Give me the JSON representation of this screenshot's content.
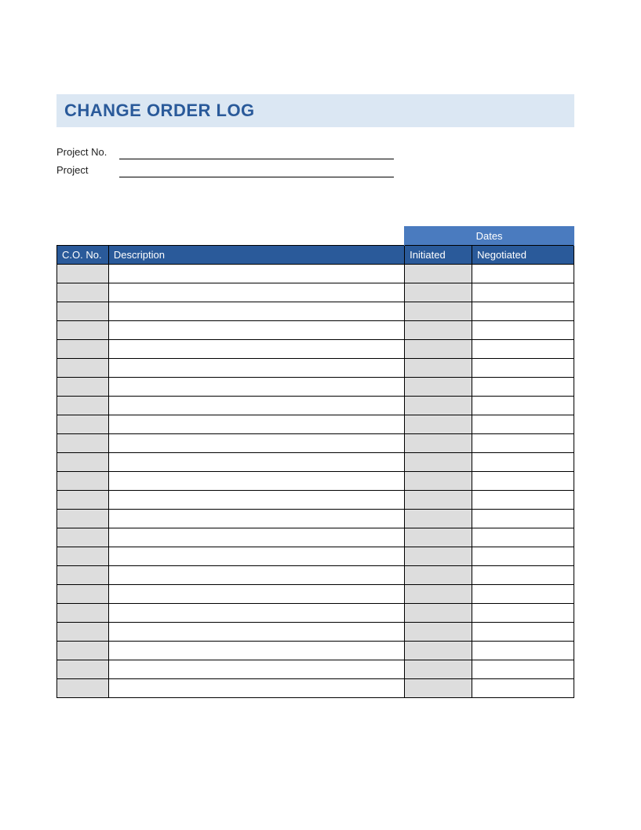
{
  "title": "CHANGE ORDER LOG",
  "meta": {
    "project_no_label": "Project No.",
    "project_no_value": "",
    "project_label": "Project",
    "project_value": ""
  },
  "table": {
    "group_header": "Dates",
    "headers": {
      "co_no": "C.O. No.",
      "description": "Description",
      "initiated": "Initiated",
      "negotiated": "Negotiated"
    },
    "rows": [
      {
        "co_no": "",
        "description": "",
        "initiated": "",
        "negotiated": ""
      },
      {
        "co_no": "",
        "description": "",
        "initiated": "",
        "negotiated": ""
      },
      {
        "co_no": "",
        "description": "",
        "initiated": "",
        "negotiated": ""
      },
      {
        "co_no": "",
        "description": "",
        "initiated": "",
        "negotiated": ""
      },
      {
        "co_no": "",
        "description": "",
        "initiated": "",
        "negotiated": ""
      },
      {
        "co_no": "",
        "description": "",
        "initiated": "",
        "negotiated": ""
      },
      {
        "co_no": "",
        "description": "",
        "initiated": "",
        "negotiated": ""
      },
      {
        "co_no": "",
        "description": "",
        "initiated": "",
        "negotiated": ""
      },
      {
        "co_no": "",
        "description": "",
        "initiated": "",
        "negotiated": ""
      },
      {
        "co_no": "",
        "description": "",
        "initiated": "",
        "negotiated": ""
      },
      {
        "co_no": "",
        "description": "",
        "initiated": "",
        "negotiated": ""
      },
      {
        "co_no": "",
        "description": "",
        "initiated": "",
        "negotiated": ""
      },
      {
        "co_no": "",
        "description": "",
        "initiated": "",
        "negotiated": ""
      },
      {
        "co_no": "",
        "description": "",
        "initiated": "",
        "negotiated": ""
      },
      {
        "co_no": "",
        "description": "",
        "initiated": "",
        "negotiated": ""
      },
      {
        "co_no": "",
        "description": "",
        "initiated": "",
        "negotiated": ""
      },
      {
        "co_no": "",
        "description": "",
        "initiated": "",
        "negotiated": ""
      },
      {
        "co_no": "",
        "description": "",
        "initiated": "",
        "negotiated": ""
      },
      {
        "co_no": "",
        "description": "",
        "initiated": "",
        "negotiated": ""
      },
      {
        "co_no": "",
        "description": "",
        "initiated": "",
        "negotiated": ""
      },
      {
        "co_no": "",
        "description": "",
        "initiated": "",
        "negotiated": ""
      },
      {
        "co_no": "",
        "description": "",
        "initiated": "",
        "negotiated": ""
      },
      {
        "co_no": "",
        "description": "",
        "initiated": "",
        "negotiated": ""
      }
    ]
  }
}
